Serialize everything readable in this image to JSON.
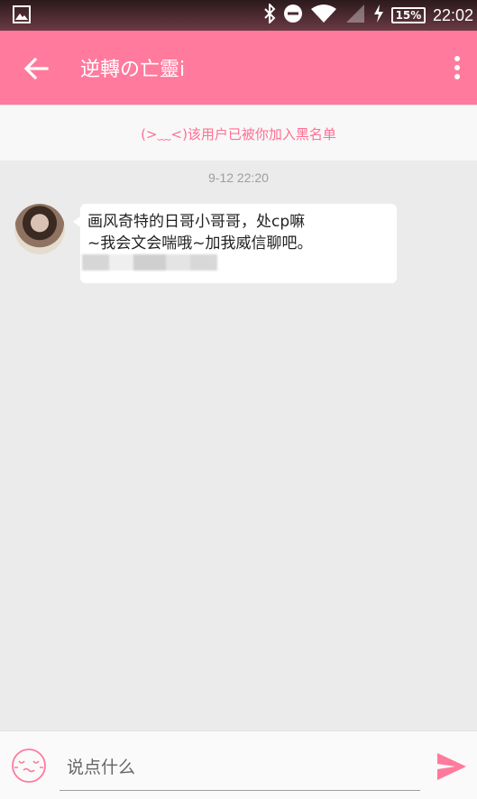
{
  "status_bar": {
    "battery": "15%",
    "time": "22:02"
  },
  "header": {
    "title": "逆轉の亡靈i"
  },
  "notice": {
    "blacklist_text": "(>﹏<)该用户已被你加入黑名单"
  },
  "conversation": {
    "timestamp": "9-12 22:20",
    "messages": [
      {
        "text": "画风奇特的日哥小哥哥，处cp嘛\n~我会文会喘哦~加我威信聊吧。"
      }
    ]
  },
  "composer": {
    "placeholder": "说点什么"
  },
  "colors": {
    "accent": "#ff7a9c",
    "notice_text": "#ff6f93",
    "background": "#ebebeb"
  }
}
